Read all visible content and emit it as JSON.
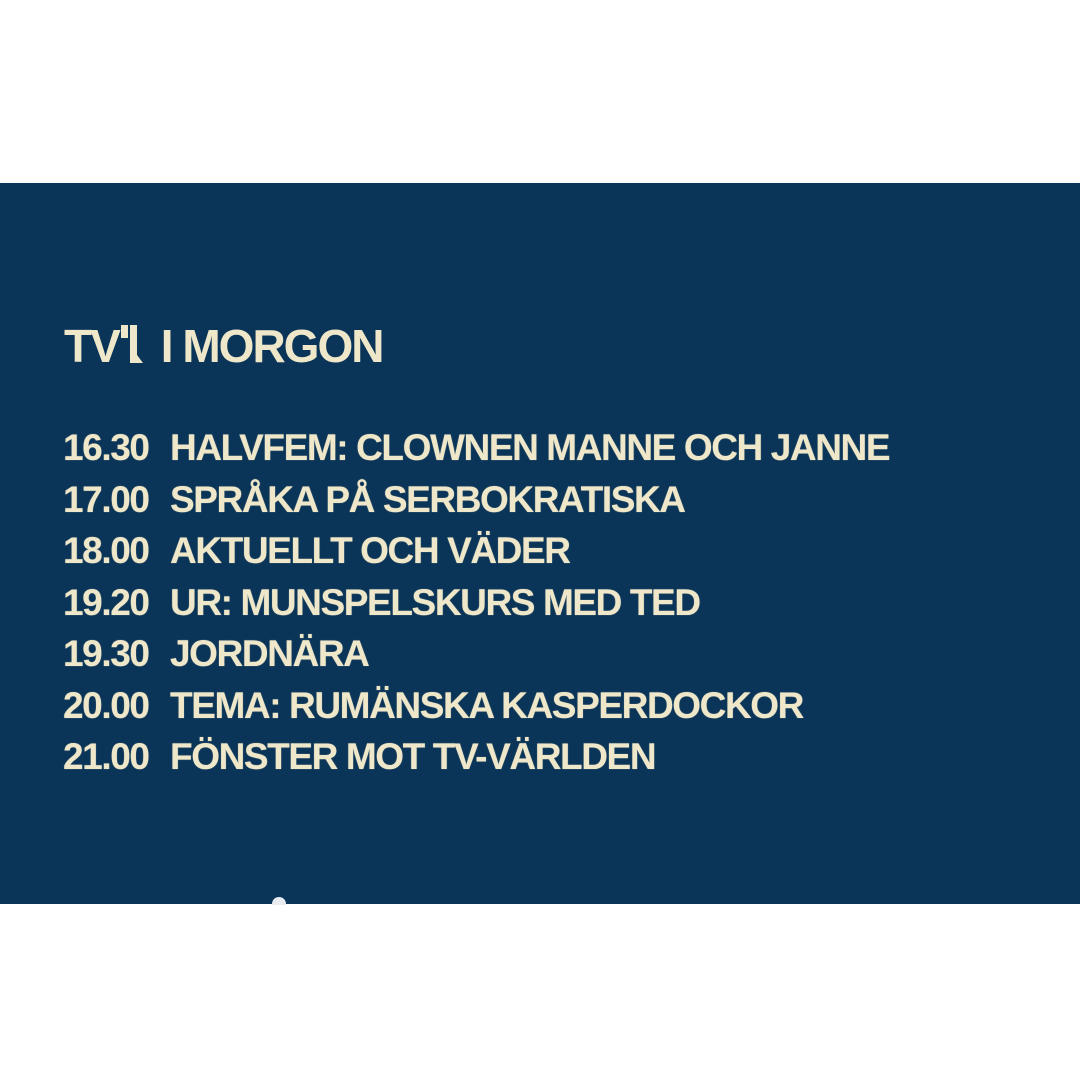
{
  "header": {
    "logo_text": "TV",
    "logo_icon": "tv1-logo-one-icon",
    "title": "I MORGON"
  },
  "schedule": [
    {
      "time": "16.30",
      "program": "HALVFEM: CLOWNEN MANNE OCH JANNE"
    },
    {
      "time": "17.00",
      "program": "SPRÅKA PÅ SERBOKRATISKA"
    },
    {
      "time": "18.00",
      "program": "AKTUELLT OCH VÄDER"
    },
    {
      "time": "19.20",
      "program": "UR: MUNSPELSKURS MED TED"
    },
    {
      "time": "19.30",
      "program": "JORDNÄRA"
    },
    {
      "time": "20.00",
      "program": "TEMA: RUMÄNSKA KASPERDOCKOR"
    },
    {
      "time": "21.00",
      "program": "FÖNSTER MOT TV-VÄRLDEN"
    }
  ],
  "colors": {
    "background": "#0b3558",
    "text": "#efe7c9",
    "frame": "#ffffff"
  }
}
